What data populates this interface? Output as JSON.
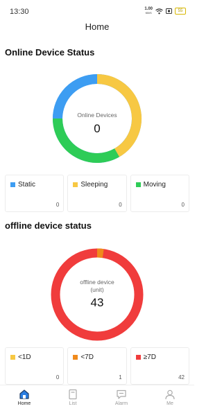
{
  "status_bar": {
    "time": "13:30",
    "net_speed_value": "1.00",
    "net_speed_unit": "KB/S",
    "battery": "55"
  },
  "header": {
    "title": "Home"
  },
  "online": {
    "title": "Online Device Status",
    "center_label": "Online Devices",
    "center_value": "0",
    "colors": [
      "#3d9df2",
      "#f7c843",
      "#2ecc57"
    ],
    "segments": [
      0.25,
      0.4167,
      0.3333
    ],
    "cards": [
      {
        "label": "Static",
        "value": "0",
        "color": "#3d9df2"
      },
      {
        "label": "Sleeping",
        "value": "0",
        "color": "#f7c843"
      },
      {
        "label": "Moving",
        "value": "0",
        "color": "#2ecc57"
      }
    ]
  },
  "offline": {
    "title": "offline device status",
    "center_label_line1": "offline device",
    "center_label_line2": "(unit)",
    "center_value": "43",
    "cards": [
      {
        "label": "<1D",
        "value": "0",
        "color": "#f7c843"
      },
      {
        "label": "<7D",
        "value": "1",
        "color": "#f08a1c"
      },
      {
        "label": "≥7D",
        "value": "42",
        "color": "#f03c3c"
      }
    ]
  },
  "tabs": [
    {
      "label": "Home",
      "icon": "home-icon",
      "active": true
    },
    {
      "label": "List",
      "icon": "list-icon",
      "active": false
    },
    {
      "label": "Alarm",
      "icon": "alarm-icon",
      "active": false
    },
    {
      "label": "Me",
      "icon": "user-icon",
      "active": false
    }
  ]
}
